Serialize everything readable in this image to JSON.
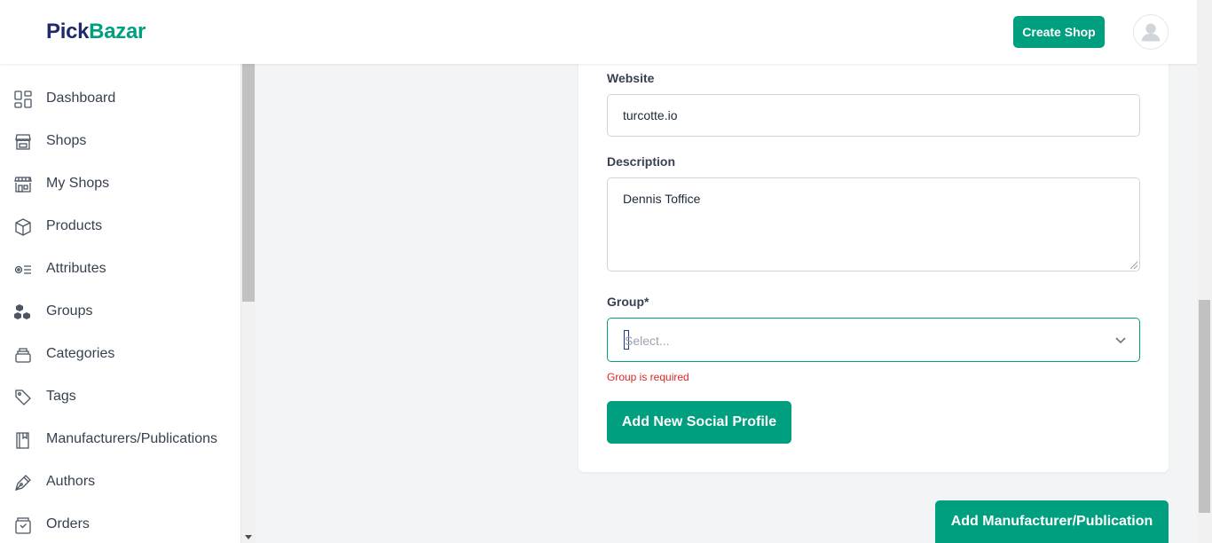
{
  "header": {
    "logo_part1": "Pick",
    "logo_part2": "Bazar",
    "create_shop_label": "Create Shop"
  },
  "sidebar": {
    "items": [
      {
        "label": "Dashboard",
        "icon": "dashboard-icon"
      },
      {
        "label": "Shops",
        "icon": "shop-icon"
      },
      {
        "label": "My Shops",
        "icon": "my-shops-icon"
      },
      {
        "label": "Products",
        "icon": "box-icon"
      },
      {
        "label": "Attributes",
        "icon": "attributes-icon"
      },
      {
        "label": "Groups",
        "icon": "groups-icon"
      },
      {
        "label": "Categories",
        "icon": "categories-icon"
      },
      {
        "label": "Tags",
        "icon": "tag-icon"
      },
      {
        "label": "Manufacturers/Publications",
        "icon": "book-icon"
      },
      {
        "label": "Authors",
        "icon": "pen-icon"
      },
      {
        "label": "Orders",
        "icon": "orders-icon"
      }
    ]
  },
  "form": {
    "website_label": "Website",
    "website_value": "turcotte.io",
    "description_label": "Description",
    "description_value": "Dennis Toffice",
    "group_label": "Group*",
    "group_placeholder": "Select...",
    "group_error": "Group is required",
    "add_social_label": "Add New Social Profile",
    "submit_label": "Add Manufacturer/Publication"
  },
  "colors": {
    "accent": "#009f7f",
    "error": "#dc2626",
    "logo_dark": "#1e2a6b"
  }
}
